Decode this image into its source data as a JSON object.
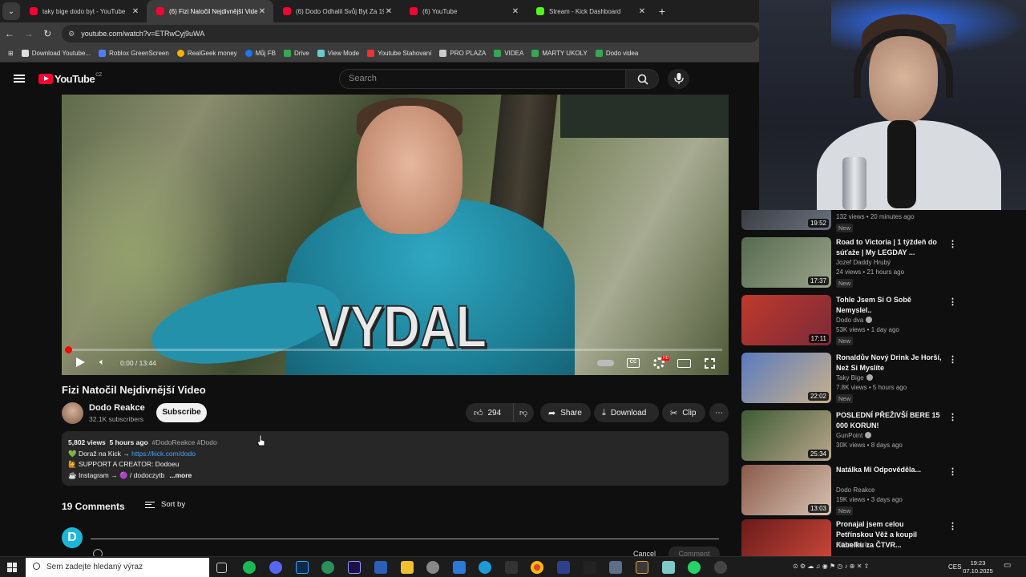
{
  "browser": {
    "tabs": [
      {
        "title": "taky bige dodo byt - YouTube",
        "icon": "youtube-icon"
      },
      {
        "title": "(6) Fizi Natočil Nejdivnější Video",
        "icon": "youtube-icon",
        "active": true
      },
      {
        "title": "(6) Dodo Odhalil Svůj Byt Za 19",
        "icon": "youtube-icon"
      },
      {
        "title": "(6) YouTube",
        "icon": "youtube-icon"
      },
      {
        "title": "Stream - Kick Dashboard",
        "icon": "kick-icon"
      }
    ],
    "url": "youtube.com/watch?v=ETRwCyj9uWA",
    "bookmarks": [
      "Download Youtube...",
      "Roblox GreenScreen",
      "RealGeek money",
      "Můj FB",
      "Drive",
      "View Mode",
      "Youtube Stahovaní",
      "PRO PLAZA",
      "VIDEA",
      "MARTY UKOLY",
      "Dodo videa"
    ]
  },
  "header": {
    "logo_text": "YouTube",
    "country_code": "CZ",
    "search_placeholder": "Search"
  },
  "player": {
    "overlay_caption": "VYDAL",
    "time": "0:00 / 13:44",
    "progress_fraction": 0.0,
    "cc_label": "CC",
    "hd_badge": "HD"
  },
  "video": {
    "title": "Fizi Natočil Nejdivnější Video",
    "channel": "Dodo Reakce",
    "subscribers": "32.1K subscribers",
    "subscribe_label": "Subscribe",
    "likes": "294",
    "share_label": "Share",
    "download_label": "Download",
    "clip_label": "Clip"
  },
  "description": {
    "views": "5,802 views",
    "age": "5 hours ago",
    "tags": "#DodoReakce #Dodo",
    "line1_prefix": "💚 Doraž na Kick →",
    "line1_link": "https://kick.com/dodo",
    "line2": "🙋 SUPPORT A CREATOR: Dodoeu",
    "line3_prefix": "☕ Instagram →",
    "line3_handle": "🟣 / dodoczytb",
    "more_label": "...more"
  },
  "comments": {
    "count_label": "19 Comments",
    "sort_label": "Sort by",
    "avatar_letter": "D",
    "cancel_label": "Cancel",
    "comment_label": "Comment"
  },
  "recommendations": [
    {
      "title": "",
      "channel": "",
      "meta": "132 views • 20 minutes ago",
      "badge": "New",
      "duration": "19:52"
    },
    {
      "title": "Road to Victoria | 1 týždeň do súťaže | My LEGDAY ...",
      "channel": "Jozef Daddy Hrubý",
      "meta": "24 views • 21 hours ago",
      "badge": "New",
      "duration": "17:37"
    },
    {
      "title": "Tohle Jsem Si O Sobě Nemyslel..",
      "channel": "Dodo dva",
      "meta": "53K views • 1 day ago",
      "badge": "New",
      "duration": "17:11"
    },
    {
      "title": "Ronaldův Nový Drink Je Horší, Než Si Myslíte",
      "channel": "Taky Bige",
      "meta": "7.8K views • 5 hours ago",
      "badge": "New",
      "duration": "22:02"
    },
    {
      "title": "POSLEDNÍ PŘEŽIVŠÍ BERE 15 000 KORUN!",
      "channel": "GunPoint",
      "meta": "30K views • 8 days ago",
      "badge": "",
      "duration": "25:34"
    },
    {
      "title": "Natálka Mi Odpověděla...",
      "channel": "Dodo Reakce",
      "meta": "19K views • 3 days ago",
      "badge": "New",
      "duration": "13:03"
    },
    {
      "title": "Pronajal jsem celou Petřínskou Věž a koupil Kabelku za ČTVR...",
      "channel": "Adam Bórik",
      "meta": "",
      "badge": "",
      "duration": ""
    }
  ],
  "taskbar": {
    "search_placeholder": "Sem zadejte hledaný výraz",
    "language": "CES",
    "time": "19:23",
    "date": "07.10.2025"
  }
}
